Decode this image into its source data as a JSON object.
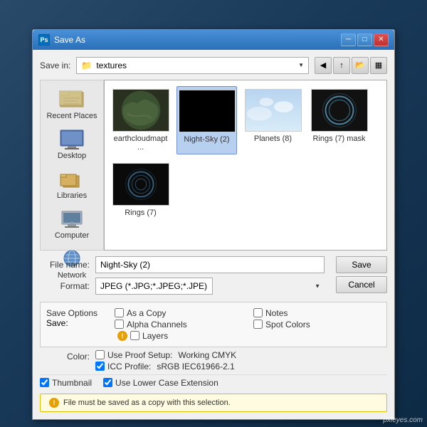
{
  "dialog": {
    "title": "Save As",
    "title_icon": "Ps",
    "save_in_label": "Save in:",
    "save_in_value": "textures",
    "file_name_label": "File name:",
    "file_name_value": "Night-Sky (2)",
    "format_label": "Format:",
    "format_value": "JPEG (*.JPG;*.JPEG;*.JPE)",
    "save_options_title": "Save Options",
    "save_label": "Save:",
    "as_copy_label": "As a Copy",
    "notes_label": "Notes",
    "alpha_channels_label": "Alpha Channels",
    "spot_colors_label": "Spot Colors",
    "layers_label": "Layers",
    "color_label": "Color:",
    "use_proof_label": "Use Proof Setup:",
    "use_proof_value": "Working CMYK",
    "icc_profile_label": "ICC Profile:",
    "icc_profile_value": "sRGB IEC61966-2.1",
    "thumbnail_label": "Thumbnail",
    "lower_case_label": "Use Lower Case Extension",
    "warning_text": "File must be saved as a copy with this selection.",
    "save_btn": "Save",
    "cancel_btn": "Cancel"
  },
  "sidebar": {
    "items": [
      {
        "label": "Recent Places",
        "icon": "recent-icon"
      },
      {
        "label": "Desktop",
        "icon": "desktop-icon"
      },
      {
        "label": "Libraries",
        "icon": "libraries-icon"
      },
      {
        "label": "Computer",
        "icon": "computer-icon"
      },
      {
        "label": "Network",
        "icon": "network-icon"
      }
    ]
  },
  "files": [
    {
      "name": "earthcloudmapt...",
      "type": "earth",
      "selected": false
    },
    {
      "name": "Night-Sky (2)",
      "type": "night",
      "selected": true
    },
    {
      "name": "Planets (8)",
      "type": "planets",
      "selected": false
    },
    {
      "name": "Rings (7) mask",
      "type": "rings-mask",
      "selected": false
    },
    {
      "name": "Rings (7)",
      "type": "rings",
      "selected": false
    }
  ],
  "checkboxes": {
    "as_copy": false,
    "notes": false,
    "alpha_channels": false,
    "spot_colors": false,
    "layers": false,
    "use_proof": false,
    "icc_profile": true,
    "thumbnail": true,
    "lower_case": true
  },
  "icons": {
    "folder": "📁",
    "warning": "⚠",
    "back": "◀",
    "up": "↑",
    "new_folder": "📂",
    "views": "▦"
  }
}
